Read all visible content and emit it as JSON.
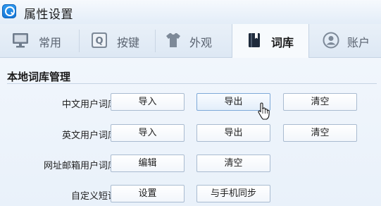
{
  "window": {
    "title": "属性设置"
  },
  "tabs": [
    {
      "label": "常用",
      "icon": "monitor-icon"
    },
    {
      "label": "按键",
      "icon": "q-key-icon"
    },
    {
      "label": "外观",
      "icon": "tshirt-icon"
    },
    {
      "label": "词库",
      "icon": "book-icon",
      "active": true
    },
    {
      "label": "账户",
      "icon": "user-icon"
    }
  ],
  "section": {
    "title": "本地词库管理"
  },
  "rows": [
    {
      "label": "中文用户词库",
      "buttons": [
        "导入",
        "导出",
        "清空"
      ]
    },
    {
      "label": "英文用户词库",
      "buttons": [
        "导入",
        "导出",
        "清空"
      ]
    },
    {
      "label": "网址邮箱用户词库",
      "buttons": [
        "编辑",
        "清空"
      ]
    },
    {
      "label": "自定义短语",
      "buttons": [
        "设置",
        "与手机同步"
      ]
    }
  ],
  "colors": {
    "accent": "#1577d8",
    "tab_text": "#5a6370",
    "button_border": "#a9bbd0"
  }
}
